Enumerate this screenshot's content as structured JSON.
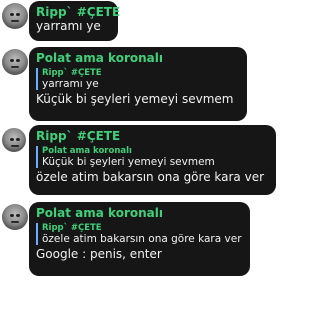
{
  "colors": {
    "bubble_bg": "#161616",
    "name_green": "#3fd07a",
    "quote_bar": "#6ab0ff",
    "text": "#f2f2f2"
  },
  "messages": [
    {
      "sender": "Ripp` #ÇETE",
      "text": "yarramı ye"
    },
    {
      "sender": "Polat ama koronalı",
      "reply_to": {
        "sender": "Ripp` #ÇETE",
        "text": "yarramı ye"
      },
      "text": "Küçük bi şeyleri yemeyi sevmem"
    },
    {
      "sender": "Ripp` #ÇETE",
      "reply_to": {
        "sender": "Polat ama koronalı",
        "text": "Küçük bi şeyleri yemeyi sevmem"
      },
      "text": "özele atim bakarsın ona göre kara ver"
    },
    {
      "sender": "Polat ama koronalı",
      "reply_to": {
        "sender": "Ripp` #ÇETE",
        "text": "özele atim bakarsın ona göre kara ver"
      },
      "text": "Google : penis, enter"
    }
  ]
}
